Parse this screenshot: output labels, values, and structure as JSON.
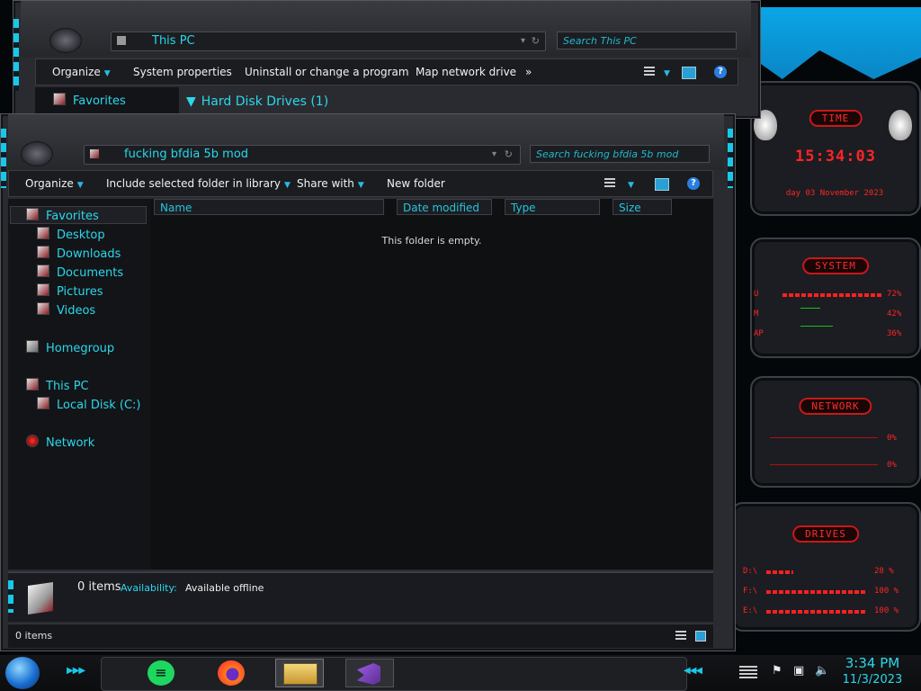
{
  "back_window": {
    "address": "This PC",
    "search_placeholder": "Search This PC",
    "commands": [
      "Organize",
      "System properties",
      "Uninstall or change a program",
      "Map network drive",
      "»"
    ],
    "nav_first": "Favorites",
    "group_header": "Hard Disk Drives (1)"
  },
  "front_window": {
    "address": "fucking bfdia 5b mod",
    "search_placeholder": "Search fucking bfdia 5b mod",
    "commands": {
      "organize": "Organize",
      "include": "Include selected folder in library",
      "share": "Share with",
      "new_folder": "New folder"
    },
    "nav": {
      "favorites": "Favorites",
      "desktop": "Desktop",
      "downloads": "Downloads",
      "documents": "Documents",
      "pictures": "Pictures",
      "videos": "Videos",
      "homegroup": "Homegroup",
      "this_pc": "This PC",
      "local_disk": "Local Disk (C:)",
      "network": "Network"
    },
    "columns": {
      "name": "Name",
      "date": "Date modified",
      "type": "Type",
      "size": "Size"
    },
    "empty_message": "This folder is empty.",
    "details": {
      "items": "0 items",
      "availability_label": "Availability:",
      "availability_value": "Available offline"
    },
    "status": {
      "items": "0 items"
    }
  },
  "gadgets": {
    "time": {
      "title": "TIME",
      "clock": "15:34:03",
      "date": "day 03 November 2023"
    },
    "system": {
      "title": "SYSTEM",
      "rows": [
        {
          "label": "U",
          "value": "72%"
        },
        {
          "label": "M",
          "value": "42%"
        },
        {
          "label": "AP",
          "value": "36%"
        }
      ]
    },
    "network": {
      "title": "NETWORK",
      "rows": [
        {
          "value": "0%"
        },
        {
          "value": "0%"
        }
      ]
    },
    "drives": {
      "title": "DRIVES",
      "rows": [
        {
          "label": "D:\\",
          "value": "28 %"
        },
        {
          "label": "F:\\",
          "value": "100 %"
        },
        {
          "label": "E:\\",
          "value": "100 %"
        }
      ]
    }
  },
  "taskbar": {
    "apps": [
      "spotify-icon",
      "firefox-icon",
      "file-explorer-icon",
      "visual-studio-icon"
    ],
    "time": "3:34 PM",
    "date": "11/3/2023"
  }
}
